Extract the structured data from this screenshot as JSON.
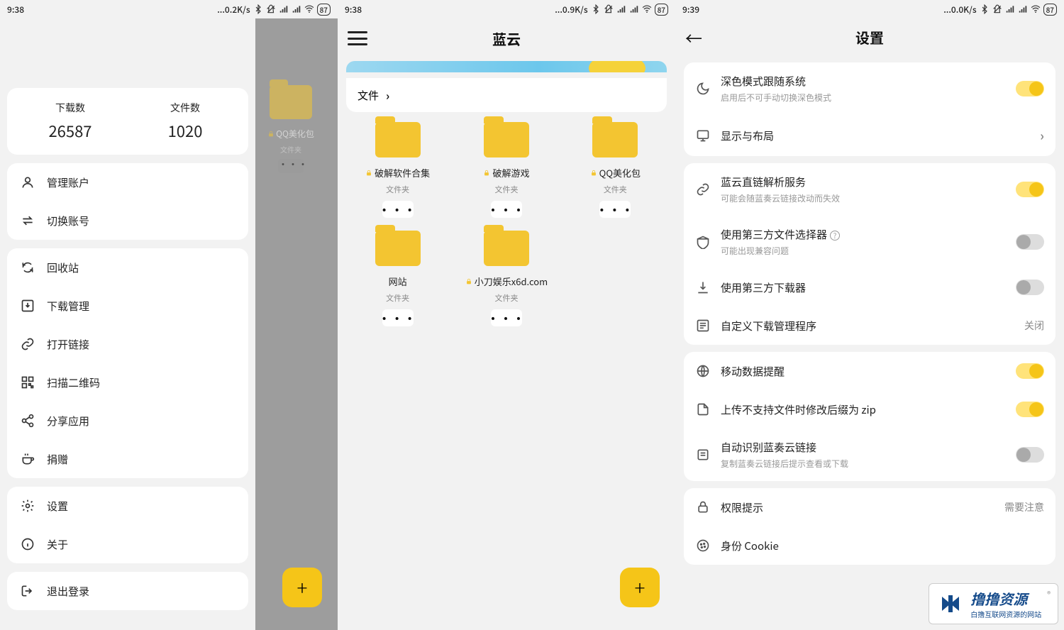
{
  "status": {
    "p1": {
      "time": "9:38",
      "net": "...0.2K/s",
      "batt": "87"
    },
    "p2": {
      "time": "9:38",
      "net": "...0.9K/s",
      "batt": "87"
    },
    "p3": {
      "time": "9:39",
      "net": "...0.0K/s",
      "batt": "87"
    }
  },
  "drawer": {
    "stats": {
      "downloads_label": "下载数",
      "downloads_value": "26587",
      "files_label": "文件数",
      "files_value": "1020"
    },
    "group1": [
      {
        "label": "管理账户",
        "name": "manage-account"
      },
      {
        "label": "切换账号",
        "name": "switch-account"
      }
    ],
    "group2": [
      {
        "label": "回收站",
        "name": "recycle-bin"
      },
      {
        "label": "下载管理",
        "name": "download-manager"
      },
      {
        "label": "打开链接",
        "name": "open-link"
      },
      {
        "label": "扫描二维码",
        "name": "scan-qr"
      },
      {
        "label": "分享应用",
        "name": "share-app"
      },
      {
        "label": "捐赠",
        "name": "donate"
      }
    ],
    "group3": [
      {
        "label": "设置",
        "name": "settings"
      },
      {
        "label": "关于",
        "name": "about"
      }
    ],
    "group4": [
      {
        "label": "退出登录",
        "name": "logout"
      }
    ]
  },
  "p1_ghost": {
    "label": "QQ美化包",
    "sub": "文件夹"
  },
  "p2": {
    "title": "蓝云",
    "crumb": "文件",
    "folders": [
      {
        "label": "破解软件合集",
        "sub": "文件夹",
        "locked": true
      },
      {
        "label": "破解游戏",
        "sub": "文件夹",
        "locked": true
      },
      {
        "label": "QQ美化包",
        "sub": "文件夹",
        "locked": true
      },
      {
        "label": "网站",
        "sub": "文件夹",
        "locked": false
      },
      {
        "label": "小刀娱乐x6d.com",
        "sub": "文件夹",
        "locked": true
      }
    ]
  },
  "p3": {
    "title": "设置",
    "g1": [
      {
        "title": "深色模式跟随系统",
        "desc": "启用后不可手动切换深色模式",
        "toggle": "on",
        "name": "dark-follow-system"
      },
      {
        "title": "显示与布局",
        "chevron": true,
        "name": "display-layout"
      }
    ],
    "g2": [
      {
        "title": "蓝云直链解析服务",
        "desc": "可能会随蓝奏云链接改动而失效",
        "toggle": "on",
        "name": "direct-link-parse"
      },
      {
        "title": "使用第三方文件选择器",
        "desc": "可能出现兼容问题",
        "toggle": "off",
        "help": true,
        "name": "third-party-picker"
      },
      {
        "title": "使用第三方下载器",
        "toggle": "off",
        "name": "third-party-downloader"
      },
      {
        "title": "自定义下载管理程序",
        "tail": "关闭",
        "name": "custom-download-manager"
      }
    ],
    "g3": [
      {
        "title": "移动数据提醒",
        "toggle": "on",
        "name": "mobile-data-warn"
      },
      {
        "title": "上传不支持文件时修改后缀为 zip",
        "toggle": "on",
        "name": "rename-zip"
      },
      {
        "title": "自动识别蓝奏云链接",
        "desc": "复制蓝奏云链接后提示查看或下载",
        "toggle": "off",
        "name": "auto-detect-link"
      }
    ],
    "g4": [
      {
        "title": "权限提示",
        "tail": "需要注意",
        "name": "permission-hint"
      },
      {
        "title": "身份 Cookie",
        "name": "identity-cookie"
      }
    ]
  },
  "watermark": {
    "l1": "撸撸资源",
    "l2": "白撸互联网资源的网站",
    "reg": "®"
  }
}
